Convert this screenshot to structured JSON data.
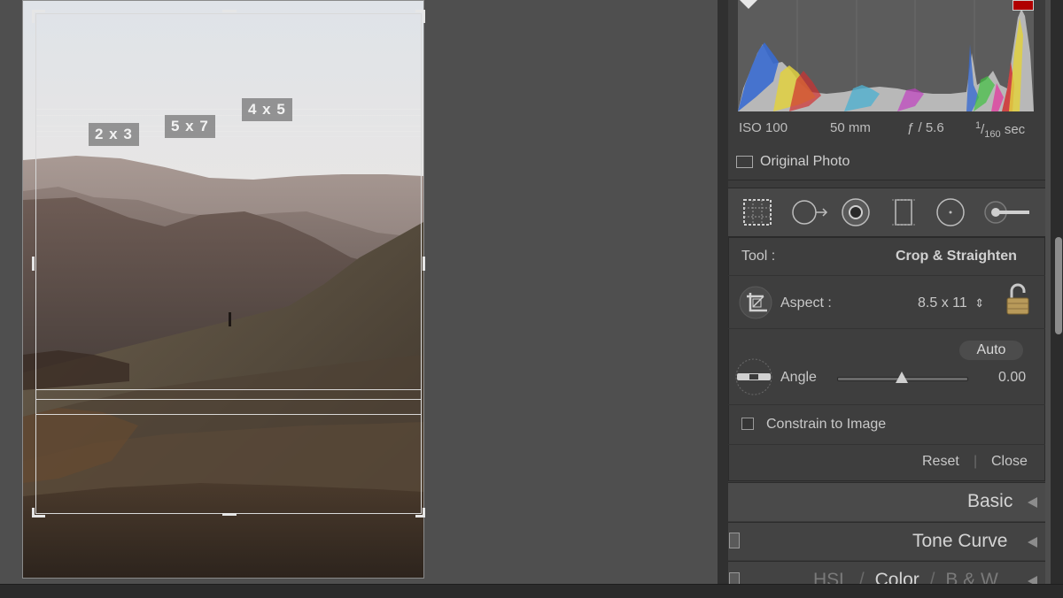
{
  "crop_overlay": {
    "ratio_labels": [
      "2 x 3",
      "5 x 7",
      "4 x 5"
    ]
  },
  "histogram": {
    "iso": "ISO 100",
    "focal_length": "50 mm",
    "aperture": "ƒ / 5.6",
    "shutter_num": "1",
    "shutter_den": "160",
    "shutter_unit": "sec",
    "original_photo_label": "Original Photo"
  },
  "tool_strip": {
    "icons": [
      "crop-overlay-icon",
      "spot-removal-icon",
      "red-eye-icon",
      "graduated-filter-icon",
      "radial-filter-icon",
      "adjustment-brush-icon"
    ]
  },
  "crop_panel": {
    "tool_label": "Tool :",
    "tool_value": "Crop & Straighten",
    "aspect_label": "Aspect :",
    "aspect_value": "8.5 x 11",
    "aspect_stepper": "⇕",
    "auto_label": "Auto",
    "angle_label": "Angle",
    "angle_value": "0.00",
    "angle_fraction": 0.5,
    "constrain_label": "Constrain to Image",
    "reset_label": "Reset",
    "separator": "|",
    "close_label": "Close"
  },
  "sections": {
    "basic": "Basic",
    "tone_curve": "Tone Curve",
    "hsl_hsl": "HSL",
    "hsl_slash1": "/",
    "hsl_color": "Color",
    "hsl_slash2": "/",
    "hsl_bw": "B & W"
  },
  "colors": {
    "clip_highlight": "#b00000",
    "panel_bg": "#3b3b3b"
  }
}
